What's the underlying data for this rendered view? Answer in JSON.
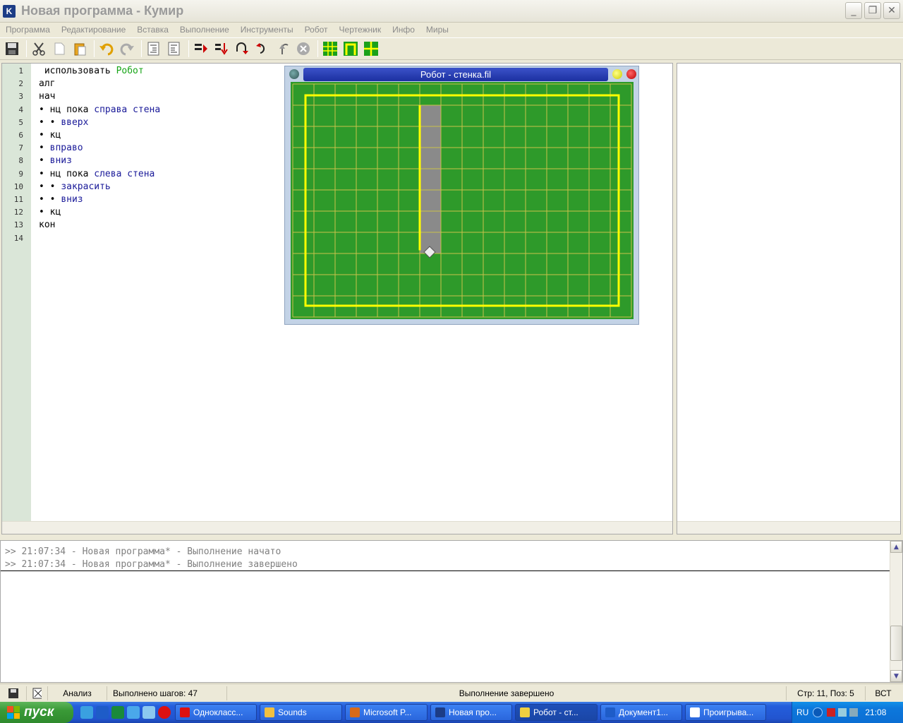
{
  "window": {
    "title": "Новая программа - Кумир",
    "icon_letter": "K"
  },
  "menu": [
    "Программа",
    "Редактирование",
    "Вставка",
    "Выполнение",
    "Инструменты",
    "Робот",
    "Чертежник",
    "Инфо",
    "Миры"
  ],
  "toolbar": {
    "icons": [
      "save-icon",
      "cut-icon",
      "copy-icon",
      "paste-icon",
      "undo-icon",
      "redo-icon",
      "indent-icon",
      "unindent-icon",
      "run-icon",
      "step-icon",
      "step-into-icon",
      "step-out-icon",
      "step-over-icon",
      "stop-icon",
      "grid-icon",
      "wall-icon",
      "field-icon"
    ]
  },
  "editor": {
    "lines": [
      {
        "num": "1",
        "indent": "",
        "parts": [
          {
            "t": " использовать ",
            "c": "kw"
          },
          {
            "t": "Робот",
            "c": "lib"
          }
        ]
      },
      {
        "num": "2",
        "indent": "",
        "parts": [
          {
            "t": "алг",
            "c": "kw"
          }
        ]
      },
      {
        "num": "3",
        "indent": "",
        "parts": [
          {
            "t": "нач",
            "c": "kw"
          }
        ]
      },
      {
        "num": "4",
        "indent": "• ",
        "parts": [
          {
            "t": "нц пока ",
            "c": "kw"
          },
          {
            "t": "справа стена",
            "c": "cmd"
          }
        ]
      },
      {
        "num": "5",
        "indent": "• • ",
        "parts": [
          {
            "t": "вверх",
            "c": "cmd"
          }
        ]
      },
      {
        "num": "6",
        "indent": "• ",
        "parts": [
          {
            "t": "кц",
            "c": "kw"
          }
        ]
      },
      {
        "num": "7",
        "indent": "• ",
        "parts": [
          {
            "t": "вправо",
            "c": "cmd"
          }
        ]
      },
      {
        "num": "8",
        "indent": "• ",
        "parts": [
          {
            "t": "вниз",
            "c": "cmd"
          }
        ]
      },
      {
        "num": "9",
        "indent": "• ",
        "parts": [
          {
            "t": "нц пока ",
            "c": "kw"
          },
          {
            "t": "слева стена",
            "c": "cmd"
          }
        ]
      },
      {
        "num": "10",
        "indent": "• • ",
        "parts": [
          {
            "t": "закрасить",
            "c": "cmd"
          }
        ]
      },
      {
        "num": "11",
        "indent": "• • ",
        "parts": [
          {
            "t": "вниз",
            "c": "cmd"
          }
        ]
      },
      {
        "num": "12",
        "indent": "• ",
        "parts": [
          {
            "t": "кц",
            "c": "kw"
          }
        ]
      },
      {
        "num": "13",
        "indent": "",
        "parts": [
          {
            "t": "кон",
            "c": "kw"
          }
        ]
      },
      {
        "num": "14",
        "indent": "",
        "parts": []
      }
    ]
  },
  "robot": {
    "title": "Робот - стенка.fil",
    "cols": 16,
    "rows": 11,
    "field_color": "#2e9a2a",
    "grid_color": "#c9c24a",
    "wall_color": "#ffff00",
    "painted_color": "#8a8a8a",
    "border_rect": {
      "col_from": 1,
      "row_from": 1,
      "col_to": 15,
      "row_to": 10
    },
    "painted_cells": [
      [
        6,
        1
      ],
      [
        6,
        2
      ],
      [
        6,
        3
      ],
      [
        6,
        4
      ],
      [
        6,
        5
      ],
      [
        6,
        6
      ],
      [
        6,
        7
      ]
    ],
    "inner_wall": {
      "col": 6,
      "row_from": 1,
      "row_to": 8
    },
    "robot_pos": [
      6,
      8
    ]
  },
  "output": {
    "lines": [
      ">> 21:07:34 - Новая программа* - Выполнение начато",
      ">> 21:07:34 - Новая программа* - Выполнение завершено"
    ]
  },
  "status": {
    "mode": "Анализ",
    "steps": "Выполнено шагов: 47",
    "message": "Выполнение завершено",
    "position": "Стр: 11, Поз: 5",
    "insert": "ВСТ"
  },
  "taskbar": {
    "start": "пуск",
    "tasks": [
      {
        "label": "Однокласс...",
        "color": "#d11"
      },
      {
        "label": "Sounds",
        "color": "#f0c040"
      },
      {
        "label": "Microsoft P...",
        "color": "#d86a1a"
      },
      {
        "label": "Новая про...",
        "color": "#1c3c86"
      },
      {
        "label": "Робот - ст...",
        "color": "#f0d040",
        "active": true
      },
      {
        "label": "Документ1...",
        "color": "#1e5cc8"
      },
      {
        "label": "Проигрыва...",
        "color": "#fff"
      }
    ],
    "lang": "RU",
    "time": "21:08"
  }
}
